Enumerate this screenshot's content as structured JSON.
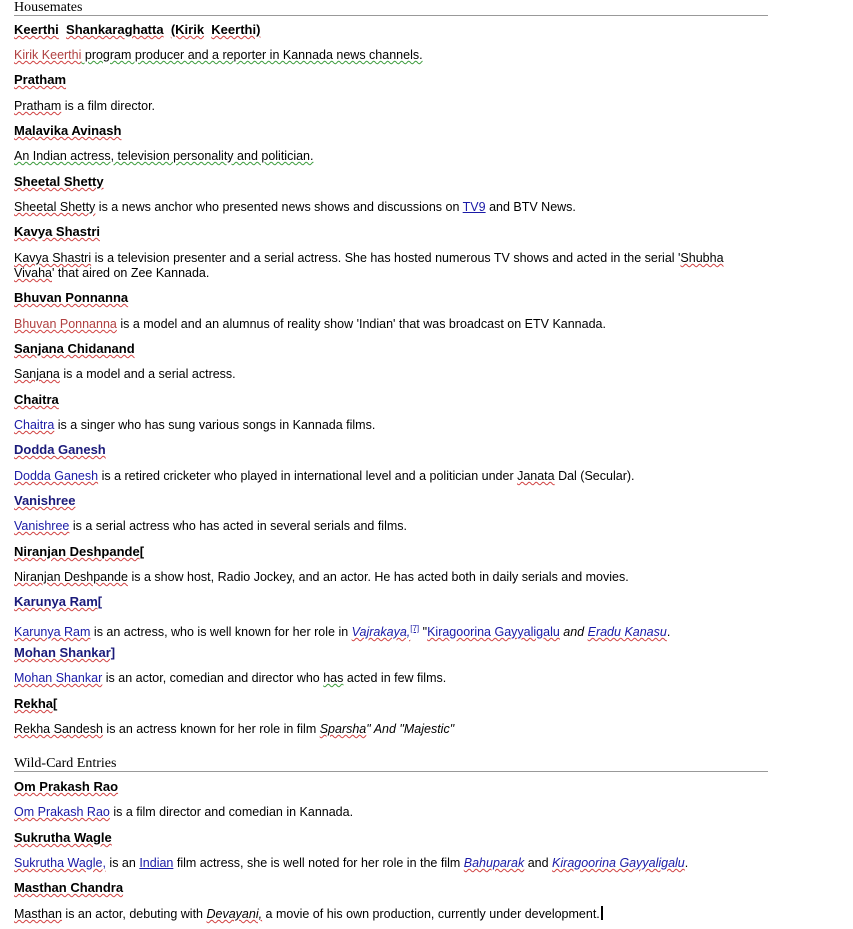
{
  "sections": {
    "housemates": "Housemates",
    "wildcard": "Wild-Card Entries"
  },
  "entries": [
    {
      "name_parts": [
        "Keerthi",
        "Shankaraghatta",
        "(Kirik",
        "Keerthi)"
      ],
      "desc_parts": [
        "Kirik Keerthi",
        " program producer and a reporter in Kannada news channels."
      ]
    },
    {
      "name_parts": [
        "Pratham"
      ],
      "desc_parts": [
        "Pratham",
        " is a  film director."
      ]
    },
    {
      "name_parts": [
        "Malavika Avinash"
      ],
      "desc_parts": [
        "An Indian actress, television personality and politician."
      ]
    },
    {
      "name_parts": [
        "Sheetal  Shetty"
      ],
      "desc_parts": [
        "Sheetal Shetty",
        " is a news anchor who presented news shows and discussions on ",
        "TV9",
        " and BTV News."
      ]
    },
    {
      "name_parts": [
        "Kavya  Shastri"
      ],
      "desc_parts": [
        "Kavya Shastri",
        " is a television presenter and a serial actress. She has hosted numerous TV shows and acted in the serial '",
        "Shubha Vivaha",
        "' that aired on Zee Kannada."
      ]
    },
    {
      "name_parts": [
        "Bhuvan  Ponnanna"
      ],
      "desc_parts": [
        "Bhuvan Ponnanna",
        " is a model and an alumnus of reality show 'Indian' that was broadcast on ETV Kannada."
      ]
    },
    {
      "name_parts": [
        "Sanjana Chidanand"
      ],
      "desc_parts": [
        "Sanjana",
        " is a model and a serial actress."
      ]
    },
    {
      "name_parts": [
        "Chaitra"
      ],
      "desc_parts": [
        "Chaitra",
        "  is a singer who has sung various songs in Kannada films."
      ]
    },
    {
      "name_parts": [
        "Dodda Ganesh"
      ],
      "desc_parts": [
        "Dodda Ganesh",
        " is a retired cricketer who played in international level and a politician under ",
        "Janata",
        " Dal (Secular)."
      ]
    },
    {
      "name_parts": [
        "Vanishree"
      ],
      "desc_parts": [
        "Vanishree",
        "  is a serial actress who has acted in several serials and films."
      ]
    },
    {
      "name_parts": [
        "Niranjan  Deshpande["
      ],
      "desc_parts": [
        "Niranjan  Deshpande",
        " is a show host, Radio Jockey, and an actor. He has acted both in daily serials and movies."
      ]
    },
    {
      "name_parts": [
        "Karunya Ram["
      ],
      "desc_parts": [
        "Karunya Ram",
        " is an actress, who is well known for her role in ",
        "Vajrakaya,",
        "[7]",
        "  \"",
        "Kiragoorina Gayyaligalu",
        " and ",
        "Eradu Kanasu",
        "."
      ]
    },
    {
      "name_parts": [
        "Mohan  Shankar]"
      ],
      "desc_parts": [
        "Mohan Shankar",
        "  is an actor, comedian and director who ",
        "has",
        " acted in few films."
      ]
    },
    {
      "name_parts": [
        "Rekha["
      ],
      "desc_parts": [
        "Rekha  Sandesh",
        " is an actress known for her role in  film ",
        "Sparsha",
        "\" And \"Majestic\""
      ]
    }
  ],
  "wildcards": [
    {
      "name_parts": [
        "Om  Prakash  Rao"
      ],
      "desc_parts": [
        "Om Prakash Rao",
        " is a film director and comedian in Kannada."
      ]
    },
    {
      "name_parts": [
        "Sukrutha  Wagle"
      ],
      "desc_parts": [
        "Sukrutha Wagle,",
        "  is an ",
        "Indian",
        "  film actress, she is well noted for her role in the film ",
        "Bahuparak",
        "  and  ",
        "Kiragoorina  Gayyaligalu",
        "."
      ]
    },
    {
      "name_parts": [
        "Masthan  Chandra"
      ],
      "desc_parts": [
        "Masthan",
        " is an actor, debuting with ",
        "Devayani,",
        "  a movie of his own production, currently under  development."
      ]
    }
  ]
}
